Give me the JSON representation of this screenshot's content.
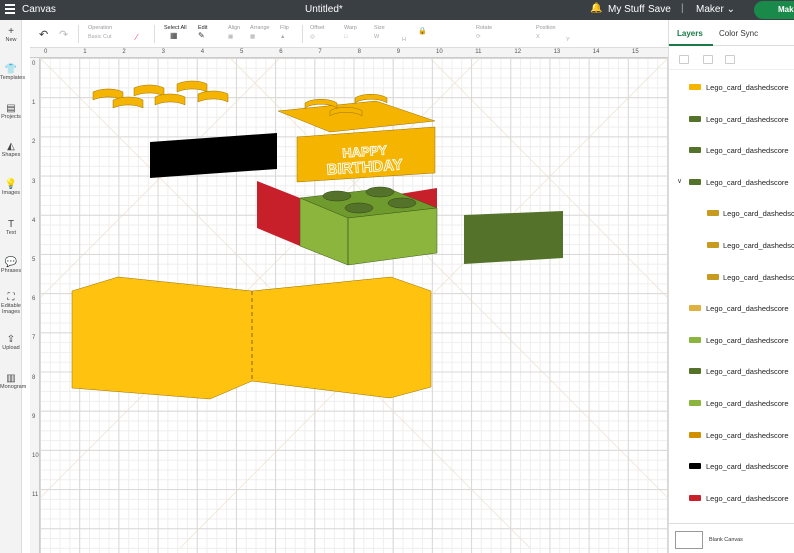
{
  "topbar": {
    "canvas_title": "Canvas",
    "doc_title": "Untitled*",
    "my_stuff": "My Stuff",
    "save": "Save",
    "separator": "|",
    "machine": "Maker",
    "make_button": "Make",
    "bell_icon": "bell-icon",
    "chevron_icon": "chevron-down-icon"
  },
  "leftnav": {
    "items": [
      {
        "label": "New",
        "icon": "+"
      },
      {
        "label": "Templates",
        "icon": "👕"
      },
      {
        "label": "Projects",
        "icon": "▤"
      },
      {
        "label": "Shapes",
        "icon": "◭"
      },
      {
        "label": "Images",
        "icon": "💡"
      },
      {
        "label": "Text",
        "icon": "T"
      },
      {
        "label": "Phrases",
        "icon": "💬"
      },
      {
        "label": "Editable Images",
        "icon": "⛶"
      },
      {
        "label": "Upload",
        "icon": "⇪"
      },
      {
        "label": "Monogram",
        "icon": "▥"
      }
    ]
  },
  "toolbar": {
    "operation": "Operation",
    "operation_value": "Basic Cut",
    "select_all": "Select All",
    "edit": "Edit",
    "align": "Align",
    "arrange": "Arrange",
    "flip": "Flip",
    "offset": "Offset",
    "warp": "Warp",
    "size": "Size",
    "rotate": "Rotate",
    "position": "Position",
    "w": "W",
    "h": "H",
    "x": "X",
    "y": "Y"
  },
  "ruler": {
    "top": [
      "0",
      "1",
      "2",
      "3",
      "4",
      "5",
      "6",
      "7",
      "8",
      "9",
      "10",
      "11",
      "12",
      "13",
      "14",
      "15"
    ],
    "left": [
      "0",
      "1",
      "2",
      "3",
      "4",
      "5",
      "6",
      "7",
      "8",
      "9",
      "10",
      "11"
    ]
  },
  "canvas": {
    "birthday_line1": "HAPPY",
    "birthday_line2": "BIRTHDAY",
    "colors": {
      "yellow": "#FFC20E",
      "orange_yellow": "#F5B400",
      "black": "#000000",
      "red": "#C8202A",
      "light_green": "#8BB53C",
      "dark_green": "#55722A",
      "mid_green": "#6E9A2E"
    }
  },
  "rightpanel": {
    "tab_layers": "Layers",
    "tab_color_sync": "Color Sync",
    "layers": [
      {
        "name": "Lego_card_dashedscore",
        "color": "#F5B400",
        "indent": false,
        "group": false
      },
      {
        "name": "Lego_card_dashedscore",
        "color": "#55722A",
        "indent": false,
        "group": false
      },
      {
        "name": "Lego_card_dashedscore",
        "color": "#55722A",
        "indent": false,
        "group": false
      },
      {
        "name": "Lego_card_dashedscore",
        "color": "#55722A",
        "indent": false,
        "group": true
      },
      {
        "name": "Lego_card_dashedscore",
        "color": "#C79A20",
        "indent": true,
        "group": false
      },
      {
        "name": "Lego_card_dashedscore",
        "color": "#C79A20",
        "indent": true,
        "group": false
      },
      {
        "name": "Lego_card_dashedscore",
        "color": "#C79A20",
        "indent": true,
        "group": false
      },
      {
        "name": "Lego_card_dashedscore",
        "color": "#E0B040",
        "indent": false,
        "group": false
      },
      {
        "name": "Lego_card_dashedscore",
        "color": "#8BB53C",
        "indent": false,
        "group": false
      },
      {
        "name": "Lego_card_dashedscore",
        "color": "#55722A",
        "indent": false,
        "group": false
      },
      {
        "name": "Lego_card_dashedscore",
        "color": "#8BB53C",
        "indent": false,
        "group": false
      },
      {
        "name": "Lego_card_dashedscore",
        "color": "#D09000",
        "indent": false,
        "group": false
      },
      {
        "name": "Lego_card_dashedscore",
        "color": "#000000",
        "indent": false,
        "group": false
      },
      {
        "name": "Lego_card_dashedscore",
        "color": "#C8202A",
        "indent": false,
        "group": false
      }
    ],
    "blank_canvas": "Blank Canvas"
  }
}
